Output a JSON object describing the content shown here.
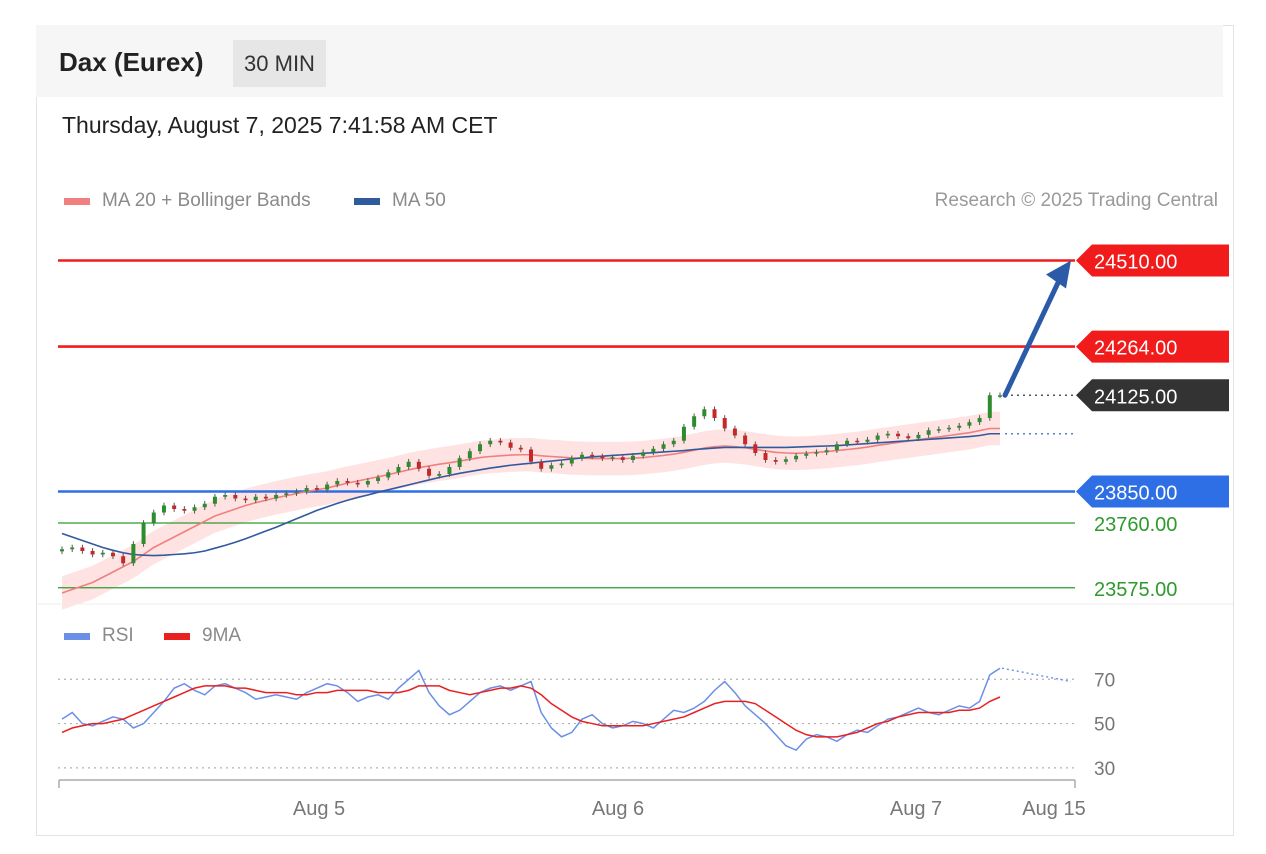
{
  "header": {
    "title": "Dax (Eurex)",
    "timeframe": "30 MIN",
    "datetime": "Thursday, August 7, 2025 7:41:58 AM CET"
  },
  "legend": {
    "ma20_label": "MA 20 + Bollinger Bands",
    "ma20_color": "#f08080",
    "ma50_label": "MA 50",
    "ma50_color": "#2f5a9e",
    "copyright": "Research © 2025 Trading Central"
  },
  "rsi_legend": {
    "rsi_label": "RSI",
    "rsi_color": "#6b8ee6",
    "ma9_label": "9MA",
    "ma9_color": "#e82020"
  },
  "chart_data": [
    {
      "type": "candlestick",
      "title": "Dax (Eurex)",
      "ylim": [
        23460,
        24620
      ],
      "price_levels": [
        {
          "value": 24510.0,
          "label": "24510.00",
          "kind": "resistance",
          "color": "#f21b1b"
        },
        {
          "value": 24264.0,
          "label": "24264.00",
          "kind": "resistance",
          "color": "#f21b1b"
        },
        {
          "value": 24125.0,
          "label": "24125.00",
          "kind": "last",
          "color": "#333333"
        },
        {
          "value": 23850.0,
          "label": "23850.00",
          "kind": "pivot",
          "color": "#2f6fe6"
        },
        {
          "value": 23760.0,
          "label": "23760.00",
          "kind": "support",
          "color": "#2e9a2e"
        },
        {
          "value": 23575.0,
          "label": "23575.00",
          "kind": "support",
          "color": "#2e9a2e"
        }
      ],
      "close": [
        23685,
        23690,
        23680,
        23670,
        23675,
        23665,
        23645,
        23700,
        23760,
        23790,
        23810,
        23800,
        23795,
        23805,
        23815,
        23835,
        23840,
        23830,
        23825,
        23835,
        23830,
        23840,
        23845,
        23850,
        23860,
        23855,
        23870,
        23880,
        23875,
        23870,
        23880,
        23890,
        23905,
        23920,
        23935,
        23915,
        23895,
        23900,
        23920,
        23945,
        23965,
        23985,
        23995,
        23990,
        23975,
        23970,
        23935,
        23915,
        23925,
        23930,
        23945,
        23955,
        23950,
        23945,
        23948,
        23940,
        23952,
        23962,
        23972,
        23985,
        23995,
        24035,
        24065,
        24085,
        24060,
        24030,
        24010,
        23985,
        23960,
        23940,
        23935,
        23942,
        23952,
        23958,
        23962,
        23968,
        23985,
        23995,
        23992,
        23998,
        24010,
        24015,
        24008,
        24002,
        24012,
        24025,
        24028,
        24032,
        24038,
        24048,
        24060,
        24125,
        24125
      ],
      "ma20": [
        23560,
        23570,
        23580,
        23590,
        23605,
        23620,
        23635,
        23650,
        23670,
        23690,
        23705,
        23720,
        23735,
        23750,
        23765,
        23780,
        23790,
        23800,
        23810,
        23818,
        23825,
        23832,
        23838,
        23844,
        23850,
        23855,
        23860,
        23867,
        23874,
        23880,
        23886,
        23892,
        23898,
        23905,
        23912,
        23918,
        23923,
        23928,
        23932,
        23937,
        23942,
        23947,
        23950,
        23952,
        23954,
        23955,
        23955,
        23952,
        23950,
        23948,
        23946,
        23945,
        23944,
        23944,
        23944,
        23944,
        23945,
        23947,
        23950,
        23953,
        23957,
        23962,
        23968,
        23974,
        23978,
        23980,
        23978,
        23975,
        23970,
        23966,
        23962,
        23960,
        23959,
        23960,
        23962,
        23964,
        23967,
        23970,
        23973,
        23977,
        23982,
        23986,
        23990,
        23994,
        23998,
        24002,
        24006,
        24010,
        24014,
        24018,
        24024,
        24030,
        24030
      ],
      "ma50": [
        23730,
        23720,
        23710,
        23700,
        23690,
        23682,
        23675,
        23670,
        23668,
        23667,
        23668,
        23670,
        23672,
        23675,
        23680,
        23688,
        23696,
        23705,
        23715,
        23726,
        23737,
        23748,
        23760,
        23772,
        23784,
        23796,
        23806,
        23816,
        23825,
        23833,
        23840,
        23848,
        23855,
        23862,
        23869,
        23876,
        23883,
        23890,
        23896,
        23902,
        23907,
        23912,
        23917,
        23921,
        23925,
        23928,
        23931,
        23934,
        23937,
        23940,
        23943,
        23946,
        23949,
        23951,
        23953,
        23955,
        23957,
        23959,
        23961,
        23963,
        23965,
        23967,
        23970,
        23972,
        23974,
        23976,
        23976,
        23976,
        23976,
        23976,
        23976,
        23976,
        23977,
        23978,
        23979,
        23980,
        23981,
        23983,
        23985,
        23987,
        23989,
        23991,
        23993,
        23995,
        23997,
        23999,
        24001,
        24003,
        24005,
        24007,
        24010,
        24015,
        24015
      ],
      "arrow_target": 24510,
      "x_axis_labels": [
        "Aug 5",
        "Aug 6",
        "Aug 7",
        "Aug 15"
      ]
    },
    {
      "type": "line",
      "title": "RSI",
      "ylim": [
        20,
        90
      ],
      "ticks": [
        70,
        50,
        30
      ],
      "tick_labels": [
        "70",
        "50",
        "30"
      ],
      "series": [
        {
          "name": "RSI",
          "values": [
            52,
            55,
            50,
            49,
            51,
            53,
            52,
            48,
            50,
            55,
            60,
            66,
            68,
            65,
            63,
            67,
            68,
            66,
            64,
            61,
            62,
            63,
            62,
            61,
            64,
            66,
            68,
            67,
            64,
            60,
            62,
            63,
            61,
            66,
            70,
            74,
            64,
            58,
            54,
            56,
            60,
            64,
            66,
            67,
            65,
            67,
            69,
            55,
            48,
            44,
            46,
            52,
            54,
            50,
            48,
            49,
            51,
            50,
            48,
            52,
            56,
            55,
            57,
            60,
            65,
            69,
            64,
            58,
            54,
            50,
            45,
            40,
            38,
            43,
            45,
            44,
            42,
            45,
            47,
            46,
            49,
            52,
            53,
            55,
            57,
            55,
            54,
            56,
            58,
            57,
            60,
            72,
            75
          ]
        },
        {
          "name": "9MA",
          "values": [
            46,
            48,
            49,
            50,
            50,
            51,
            52,
            54,
            56,
            58,
            60,
            62,
            64,
            66,
            67,
            67,
            67,
            66,
            66,
            65,
            64,
            64,
            64,
            63,
            63,
            64,
            64,
            65,
            65,
            65,
            65,
            64,
            64,
            64,
            65,
            67,
            67,
            67,
            65,
            64,
            63,
            64,
            65,
            66,
            66,
            67,
            66,
            63,
            59,
            56,
            53,
            51,
            50,
            49,
            49,
            49,
            49,
            49,
            50,
            51,
            52,
            53,
            55,
            57,
            59,
            60,
            60,
            60,
            59,
            56,
            53,
            50,
            47,
            45,
            44,
            44,
            44,
            45,
            46,
            48,
            50,
            51,
            53,
            54,
            55,
            55,
            55,
            55,
            56,
            56,
            57,
            60,
            62
          ]
        }
      ],
      "projection_end": 69
    }
  ]
}
